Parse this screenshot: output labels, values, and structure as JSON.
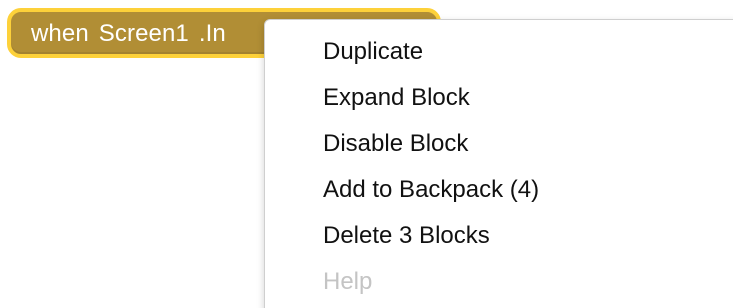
{
  "block": {
    "keyword": "when",
    "component": "Screen1",
    "event": ".In",
    "colors": {
      "fill": "#b18e35",
      "outline": "#fdd13a",
      "text": "#ffffff"
    }
  },
  "context_menu": {
    "items": [
      {
        "label": "Duplicate",
        "enabled": true
      },
      {
        "label": "Expand Block",
        "enabled": true
      },
      {
        "label": "Disable Block",
        "enabled": true
      },
      {
        "label": "Add to Backpack (4)",
        "enabled": true
      },
      {
        "label": "Delete 3 Blocks",
        "enabled": true
      },
      {
        "label": "Help",
        "enabled": false
      }
    ],
    "colors": {
      "text": "#111111",
      "disabled_text": "#c4c4c4"
    }
  }
}
